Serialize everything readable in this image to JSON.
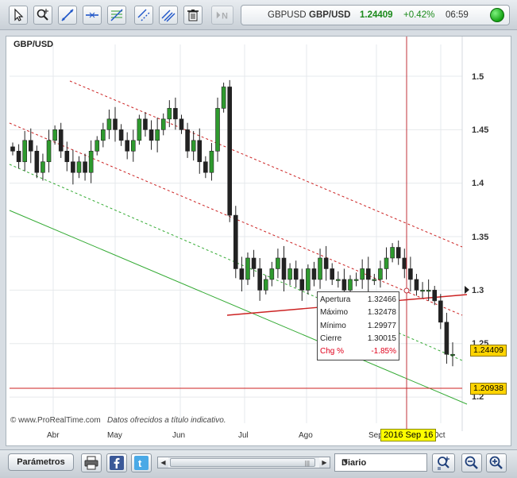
{
  "toolbar": {
    "tools": [
      "cursor-icon",
      "zoom-crosshair-icon",
      "trend-line-icon",
      "horizontal-line-icon",
      "fibonacci-icon",
      "channel-icon",
      "parallel-lines-icon",
      "trash-icon",
      "normalize-icon"
    ],
    "normalize_label": "N"
  },
  "quote": {
    "symbol": "GBPUSD",
    "name": "GBP/USD",
    "price": "1.24409",
    "change": "+0.42%",
    "time": "06:59",
    "status_color": "#1ea71e"
  },
  "chart": {
    "title": "GBP/USD",
    "copyright_url": "©  www.ProRealTime.com",
    "copyright_note": "Datos ofrecidos a título indicativo.",
    "y_ticks": [
      "1.5",
      "1.45",
      "1.4",
      "1.35",
      "1.3",
      "1.25",
      "1.2"
    ],
    "x_ticks": [
      "Abr",
      "May",
      "Jun",
      "Jul",
      "Ago",
      "Sep",
      "Oct"
    ],
    "last_price_tag": "1.24409",
    "hline_price_tag": "1.20938",
    "cursor_date": "2016 Sep 16",
    "info": {
      "rows": [
        {
          "label": "Apertura",
          "value": "1.32466"
        },
        {
          "label": "Máximo",
          "value": "1.32478"
        },
        {
          "label": "Mínimo",
          "value": "1.29977"
        },
        {
          "label": "Cierre",
          "value": "1.30015"
        },
        {
          "label": "Chg %",
          "value": "-1.85%"
        }
      ]
    },
    "colors": {
      "up": "#2e9a2e",
      "down": "#222222",
      "channel": "#cc2222",
      "support": "#33aa33",
      "hline": "#cc2222",
      "crosshair": "#c0303a"
    }
  },
  "chart_data": {
    "type": "candlestick",
    "title": "GBP/USD",
    "x_months": [
      "Abr",
      "May",
      "Jun",
      "Jul",
      "Ago",
      "Sep",
      "Oct"
    ],
    "ylim": [
      1.19,
      1.53
    ],
    "y_ticks": [
      1.2,
      1.25,
      1.3,
      1.35,
      1.4,
      1.45,
      1.5
    ],
    "period": "Diario",
    "closes_approx": [
      1.43,
      1.42,
      1.44,
      1.43,
      1.41,
      1.42,
      1.44,
      1.45,
      1.43,
      1.42,
      1.41,
      1.42,
      1.41,
      1.43,
      1.44,
      1.45,
      1.46,
      1.45,
      1.44,
      1.43,
      1.44,
      1.46,
      1.45,
      1.44,
      1.45,
      1.46,
      1.47,
      1.46,
      1.45,
      1.43,
      1.44,
      1.42,
      1.41,
      1.43,
      1.47,
      1.49,
      1.37,
      1.32,
      1.31,
      1.33,
      1.32,
      1.3,
      1.31,
      1.32,
      1.33,
      1.31,
      1.32,
      1.31,
      1.3,
      1.32,
      1.31,
      1.33,
      1.32,
      1.31,
      1.31,
      1.3,
      1.31,
      1.31,
      1.32,
      1.31,
      1.31,
      1.32,
      1.33,
      1.34,
      1.33,
      1.32,
      1.31,
      1.3,
      1.3,
      1.3,
      1.29,
      1.27,
      1.24,
      1.24
    ],
    "last_price": 1.24409,
    "horizontal_line": 1.20938,
    "selected_bar": {
      "date": "2016 Sep 16",
      "open": 1.32466,
      "high": 1.32478,
      "low": 1.29977,
      "close": 1.30015,
      "chg_pct": -1.85
    }
  },
  "bottom": {
    "params_label": "Parámetros",
    "period_value": "Diario",
    "icons": [
      "print-icon",
      "facebook-icon",
      "twitter-icon"
    ]
  }
}
